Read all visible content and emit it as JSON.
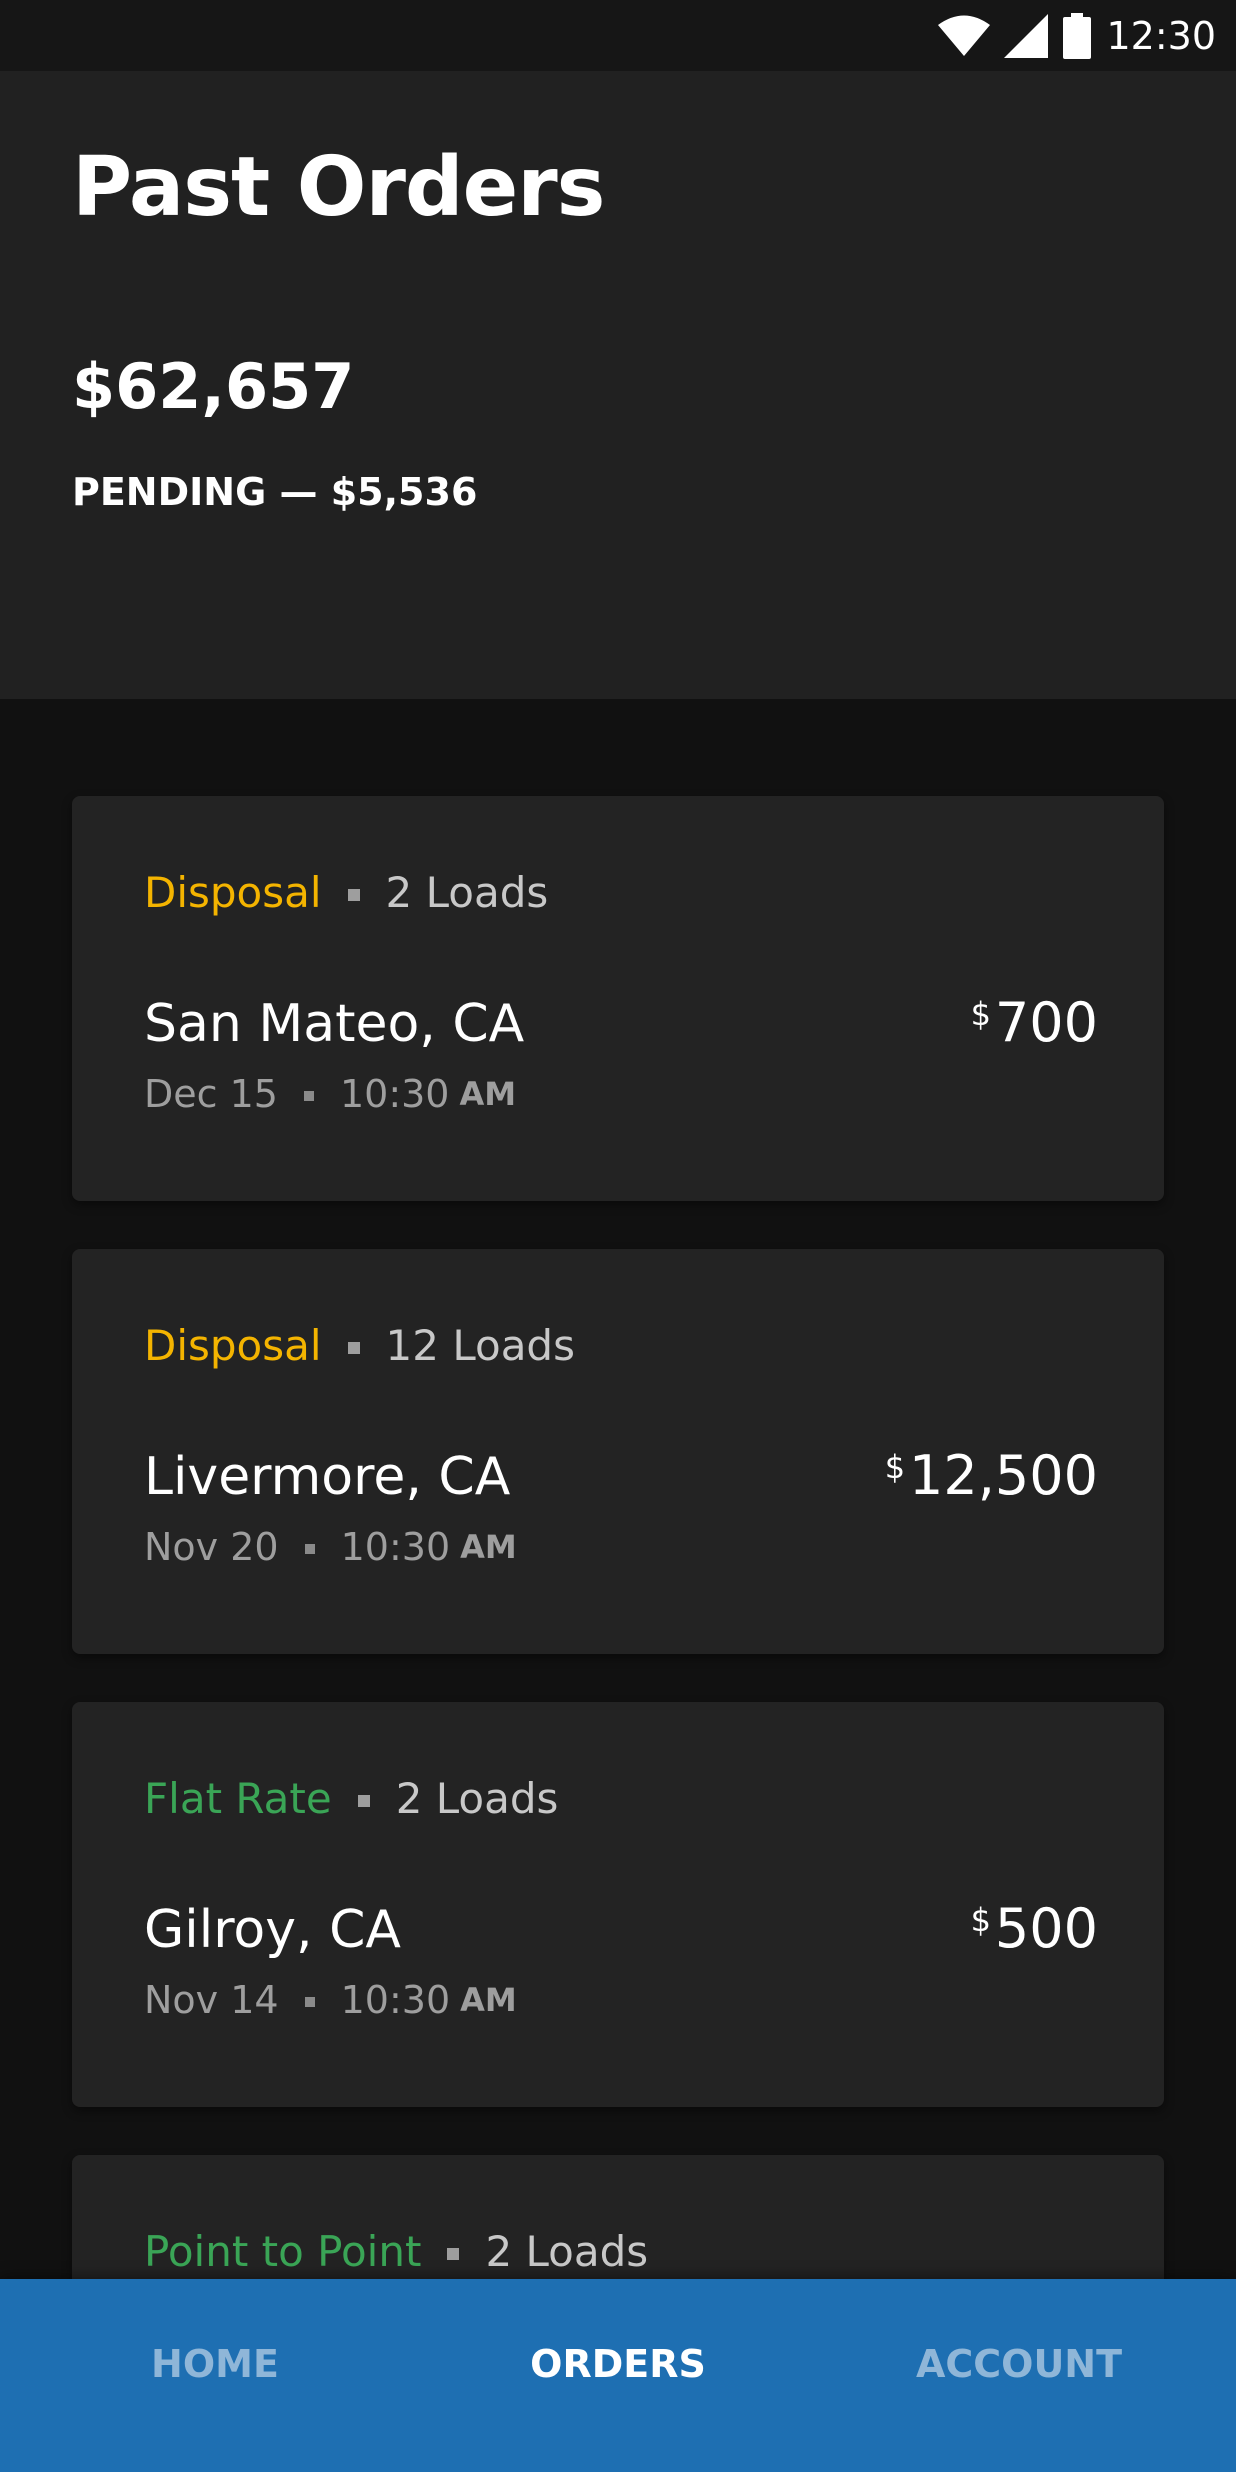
{
  "status_bar": {
    "time": "12:30",
    "icons": [
      "wifi-icon",
      "cell-signal-icon",
      "battery-icon"
    ]
  },
  "header": {
    "title": "Past Orders",
    "total": "$62,657",
    "pending": "PENDING — $5,536"
  },
  "colors": {
    "disposal": "#f4b400",
    "flat_rate": "#3aa556",
    "point_to_point": "#3aa556",
    "nav_background": "#1e6fb2"
  },
  "orders": [
    {
      "type": "Disposal",
      "loads": "2 Loads",
      "location": "San Mateo, CA",
      "date": "Dec 15",
      "time": "10:30",
      "ampm": "AM",
      "currency": "$",
      "amount": "700"
    },
    {
      "type": "Disposal",
      "loads": "12 Loads",
      "location": "Livermore, CA",
      "date": "Nov 20",
      "time": "10:30",
      "ampm": "AM",
      "currency": "$",
      "amount": "12,500"
    },
    {
      "type": "Flat Rate",
      "loads": "2 Loads",
      "location": "Gilroy, CA",
      "date": "Nov 14",
      "time": "10:30",
      "ampm": "AM",
      "currency": "$",
      "amount": "500"
    },
    {
      "type": "Point to Point",
      "loads": "2 Loads"
    }
  ],
  "bottom_nav": {
    "items": [
      {
        "label": "HOME",
        "active": false
      },
      {
        "label": "ORDERS",
        "active": true
      },
      {
        "label": "ACCOUNT",
        "active": false
      }
    ]
  }
}
